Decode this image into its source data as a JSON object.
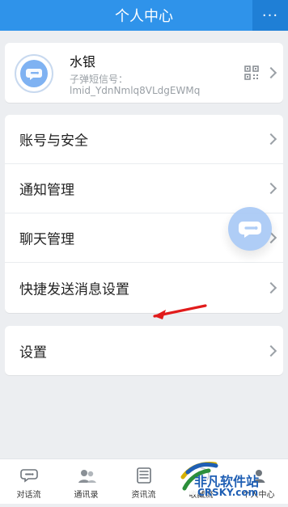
{
  "header": {
    "title": "个人中心",
    "more_label": "···"
  },
  "profile": {
    "name": "水银",
    "id_label": "子弹短信号：",
    "id_value": "lmid_YdnNmlq8VLdgEWMq",
    "avatar_icon": "chat-bubble-icon",
    "qr_icon": "qr-code-icon"
  },
  "menu": {
    "items": [
      {
        "label": "账号与安全"
      },
      {
        "label": "通知管理"
      },
      {
        "label": "聊天管理"
      },
      {
        "label": "快捷发送消息设置"
      }
    ],
    "settings": {
      "label": "设置"
    }
  },
  "floating_button": {
    "icon": "chat-bubble-icon"
  },
  "bottom_tabs": [
    {
      "label": "对话流",
      "icon": "chat-bubble-icon"
    },
    {
      "label": "通讯录",
      "icon": "contacts-icon"
    },
    {
      "label": "资讯流",
      "icon": "news-icon"
    },
    {
      "label": "收藏流",
      "icon": "bookmark-icon"
    },
    {
      "label": "个人中心",
      "icon": "person-icon"
    }
  ],
  "watermark": {
    "line1": "非凡软件站",
    "line2": "CRSKY.com"
  },
  "colors": {
    "primary": "#2f93ea",
    "background": "#eceef1",
    "accent_arrow": "#e11b1b"
  }
}
